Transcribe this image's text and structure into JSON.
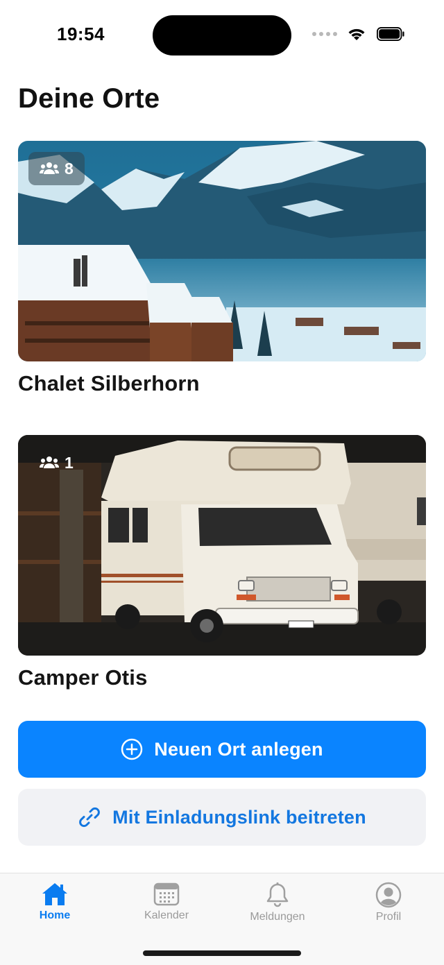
{
  "status_bar": {
    "time": "19:54"
  },
  "title": "Deine Orte",
  "places": [
    {
      "name": "Chalet Silberhorn",
      "members": "8"
    },
    {
      "name": "Camper Otis",
      "members": "1"
    }
  ],
  "buttons": {
    "new_place": "Neuen Ort anlegen",
    "join_link": "Mit Einladungslink beitreten"
  },
  "tabs": [
    {
      "label": "Home",
      "icon": "house-icon",
      "active": true
    },
    {
      "label": "Kalender",
      "icon": "calendar-icon",
      "active": false
    },
    {
      "label": "Meldungen",
      "icon": "bell-icon",
      "active": false
    },
    {
      "label": "Profil",
      "icon": "person-circle-icon",
      "active": false
    }
  ],
  "colors": {
    "accent": "#0a84ff",
    "secondary_bg": "#f1f2f5",
    "link": "#1377e0"
  }
}
